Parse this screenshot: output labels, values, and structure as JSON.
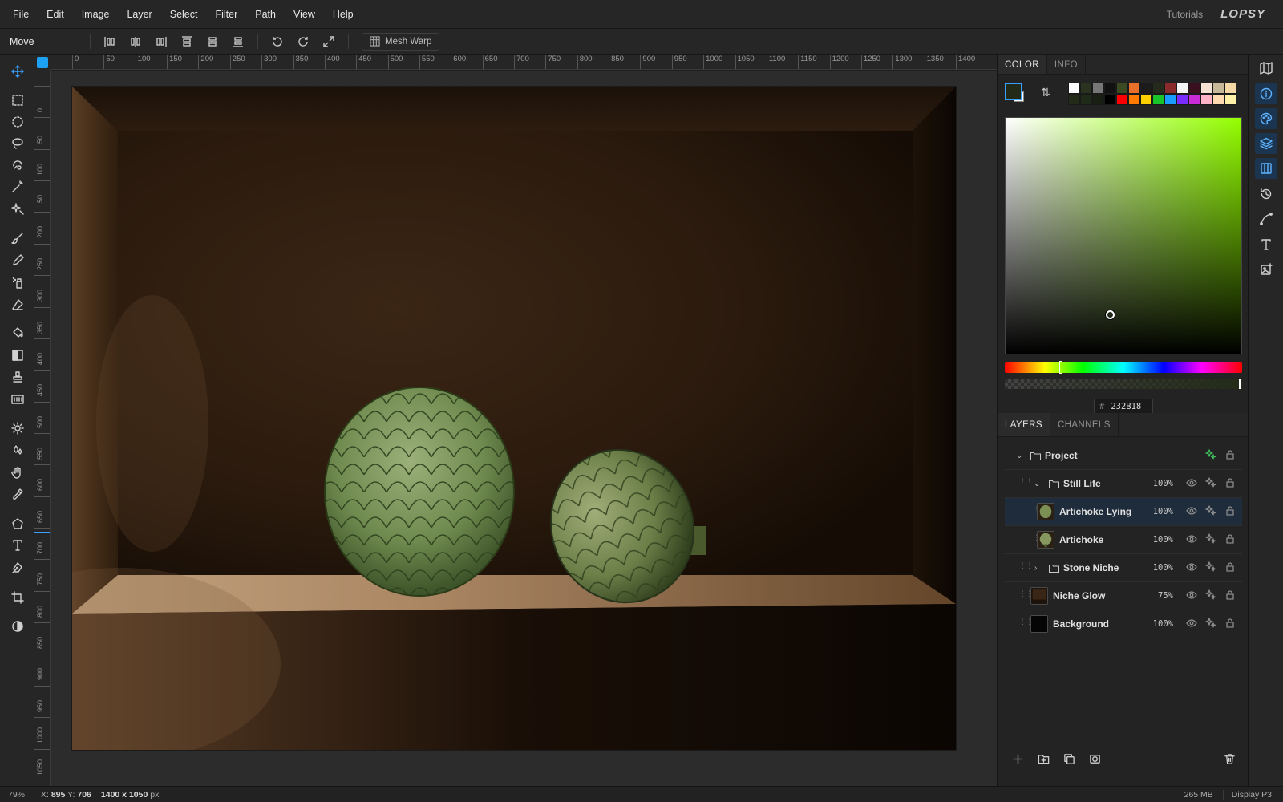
{
  "menu": [
    "File",
    "Edit",
    "Image",
    "Layer",
    "Select",
    "Filter",
    "Path",
    "View",
    "Help"
  ],
  "header": {
    "tutorials": "Tutorials",
    "logo": "LOPSY"
  },
  "options": {
    "tool_name": "Move",
    "mesh_warp": "Mesh Warp"
  },
  "ruler": {
    "h_labels": [
      "0",
      "50",
      "100",
      "150",
      "200",
      "250",
      "300",
      "350",
      "400",
      "450",
      "500",
      "550",
      "600",
      "650",
      "700",
      "750",
      "800",
      "850",
      "900",
      "950",
      "1000",
      "1050",
      "1100",
      "1150",
      "1200",
      "1250",
      "1300",
      "1350",
      "1400"
    ],
    "v_labels": [
      "0",
      "50",
      "100",
      "150",
      "200",
      "250",
      "300",
      "350",
      "400",
      "450",
      "500",
      "550",
      "600",
      "650",
      "700",
      "750",
      "800",
      "850",
      "900",
      "950",
      "1000",
      "1050"
    ]
  },
  "color_panel": {
    "tabs": [
      "COLOR",
      "INFO"
    ],
    "hex_value": "232B18",
    "foreground": "#232b18",
    "background": "#ffffff",
    "palette": [
      "#ffffff",
      "#2a3320",
      "#777777",
      "#111111",
      "#3b4a22",
      "#e8702a",
      "#1b1b1b",
      "#242a1c",
      "#8a2a2a",
      "#f5f5f5",
      "#3a1020",
      "#f6e2d2",
      "#c8b89a",
      "#f4d9a6",
      "#232b18",
      "#1f2a18",
      "#1a1f14",
      "#000000",
      "#ff0000",
      "#ff7a00",
      "#ffd000",
      "#19c32a",
      "#1a9cff",
      "#7a2bff",
      "#c92bd6",
      "#ffb3c7",
      "#ffd9b0",
      "#fff2a8"
    ]
  },
  "layers_panel": {
    "tabs": [
      "LAYERS",
      "CHANNELS"
    ],
    "layers": [
      {
        "name": "Project",
        "opacity": "",
        "kind": "group"
      },
      {
        "name": "Still Life",
        "opacity": "100%",
        "kind": "group"
      },
      {
        "name": "Artichoke Lying",
        "opacity": "100%",
        "kind": "layer"
      },
      {
        "name": "Artichoke",
        "opacity": "100%",
        "kind": "layer"
      },
      {
        "name": "Stone Niche",
        "opacity": "100%",
        "kind": "group"
      },
      {
        "name": "Niche Glow",
        "opacity": "75%",
        "kind": "layer"
      },
      {
        "name": "Background",
        "opacity": "100%",
        "kind": "layer"
      }
    ]
  },
  "status": {
    "zoom": "79%",
    "x_label": "X:",
    "x_value": "895",
    "y_label": "Y:",
    "y_value": "706",
    "doc_dims": "1400 x 1050",
    "doc_unit": "px",
    "memory": "265 MB",
    "color_profile": "Display P3"
  }
}
